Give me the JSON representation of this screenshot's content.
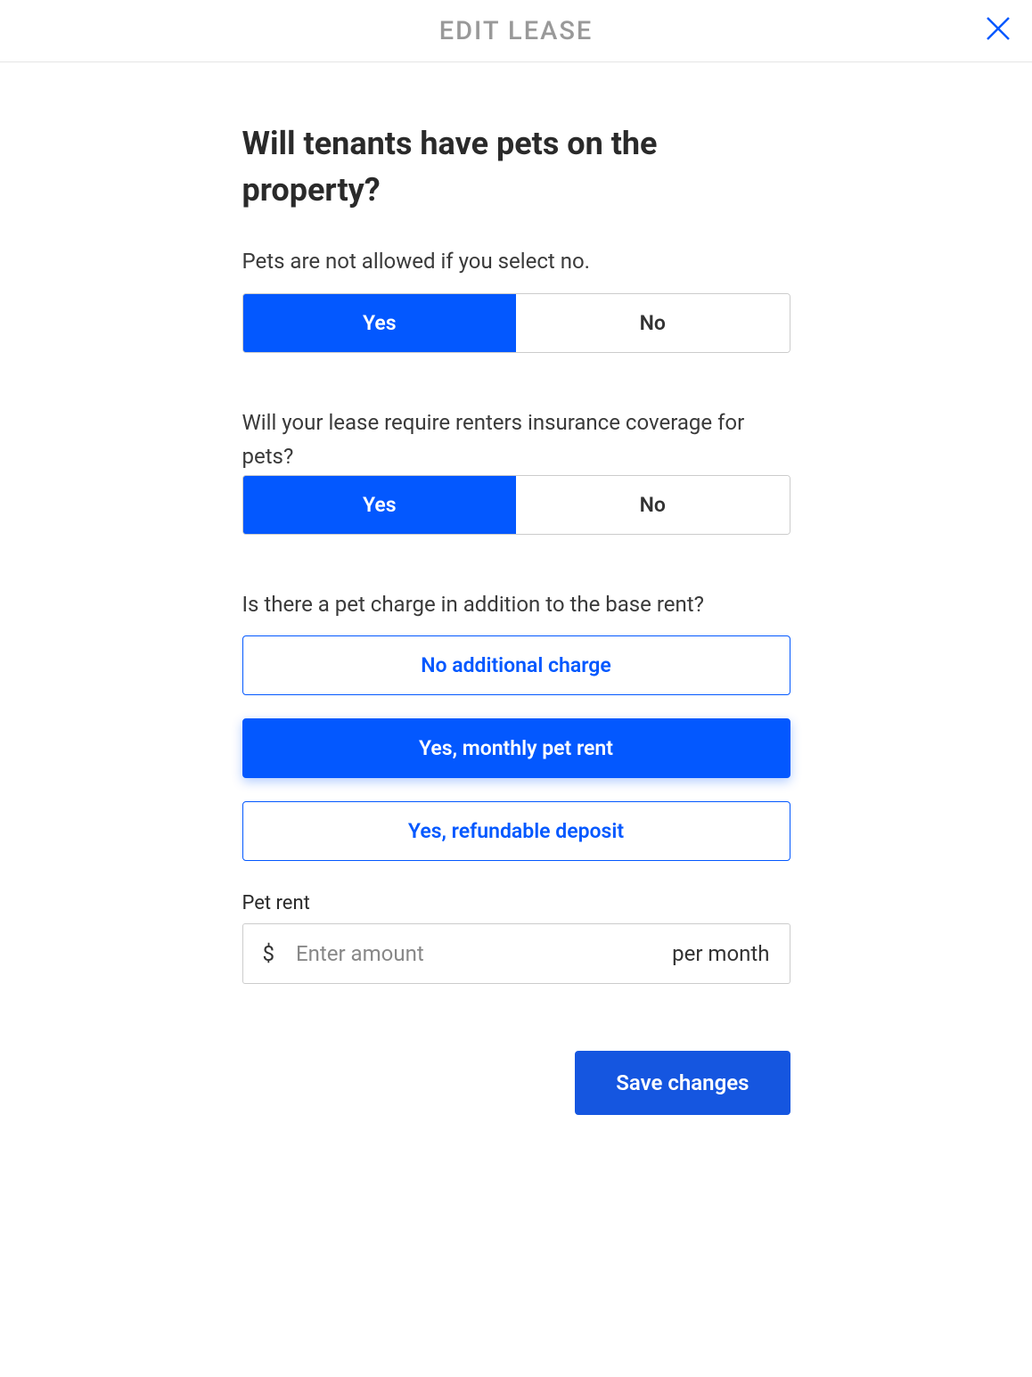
{
  "header": {
    "title": "EDIT LEASE"
  },
  "main": {
    "question": "Will tenants have pets on the property?",
    "subtitle": "Pets are not allowed if you select no.",
    "pets_toggle": {
      "yes": "Yes",
      "no": "No",
      "selected": "yes"
    },
    "insurance_question": "Will your lease require renters insurance coverage for pets?",
    "insurance_toggle": {
      "yes": "Yes",
      "no": "No",
      "selected": "yes"
    },
    "charge_question": "Is there a pet charge in addition to the base rent?",
    "charge_options": {
      "none": "No additional charge",
      "monthly": "Yes, monthly pet rent",
      "deposit": "Yes, refundable deposit",
      "selected": "monthly"
    },
    "pet_rent": {
      "label": "Pet rent",
      "currency": "$",
      "placeholder": "Enter amount",
      "value": "",
      "unit": "per month"
    }
  },
  "footer": {
    "save_label": "Save changes"
  }
}
